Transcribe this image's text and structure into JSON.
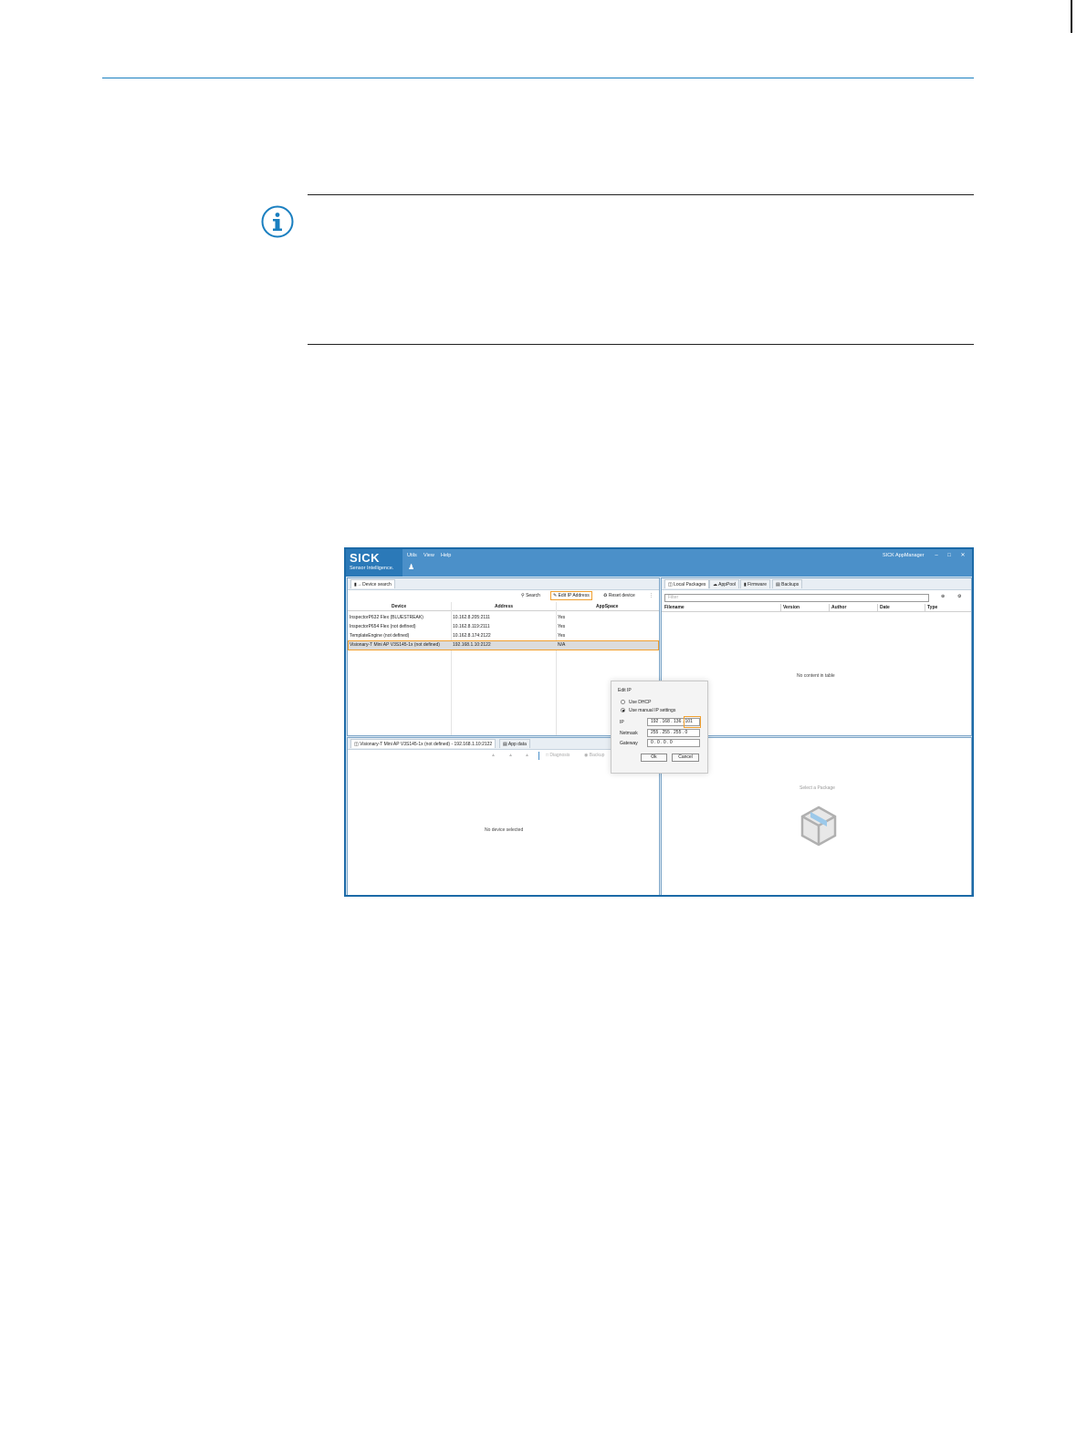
{
  "screenshot": {
    "menu": [
      "Utils",
      "View",
      "Help"
    ],
    "logo": {
      "main": "SICK",
      "sub": "Sensor Intelligence."
    },
    "app_title": "SICK AppManager",
    "device_pane": {
      "tab": "Device search",
      "toolbar": {
        "search": "Search",
        "edit_ip": "Edit IP Address",
        "reset_device": "Reset device"
      },
      "columns": [
        "Device",
        "Address",
        "AppSpace"
      ],
      "rows": [
        [
          "InspectorP632 Flex (BLUESTREAK)",
          "10.162.8.205:2111",
          "Yes"
        ],
        [
          "InspectorP654 Flex (not defined)",
          "10.162.8.119:2111",
          "Yes"
        ],
        [
          "TemplateEngine (not defined)",
          "10.162.8.174:2122",
          "Yes"
        ],
        [
          "Visionary-T Mini AP V3S145-1x (not defined)",
          "192.168.1.10:2122",
          "N/A"
        ]
      ]
    },
    "packages_pane": {
      "tabs": [
        "Local Packages",
        "AppPool",
        "Firmware",
        "Backups"
      ],
      "filter_placeholder": "Filter",
      "columns": [
        "Filename",
        "Version",
        "Author",
        "Date",
        "Type"
      ],
      "empty_message": "No content in table"
    },
    "detail_pane": {
      "tabs": [
        "Visionary-T Mini AP V3S145-1x (not defined) - 192.168.1.10:2122",
        "App data"
      ],
      "toolbar": [
        "Diagnosis",
        "Backup"
      ],
      "empty_message": "No device selected"
    },
    "package_preview": {
      "message": "Select a Package"
    },
    "edit_ip_dialog": {
      "title": "Edit IP",
      "option_dhcp": "Use DHCP",
      "option_manual": "Use manual IP settings",
      "ip_label": "IP",
      "ip_value": "192 . 168 . 136 . 101",
      "netmask_label": "Netmask",
      "netmask_value": "255 . 255 . 255 . 0",
      "gateway_label": "Gateway",
      "gateway_value": "0 . 0 . 0 . 0",
      "ok": "Ok",
      "cancel": "Cancel"
    }
  }
}
